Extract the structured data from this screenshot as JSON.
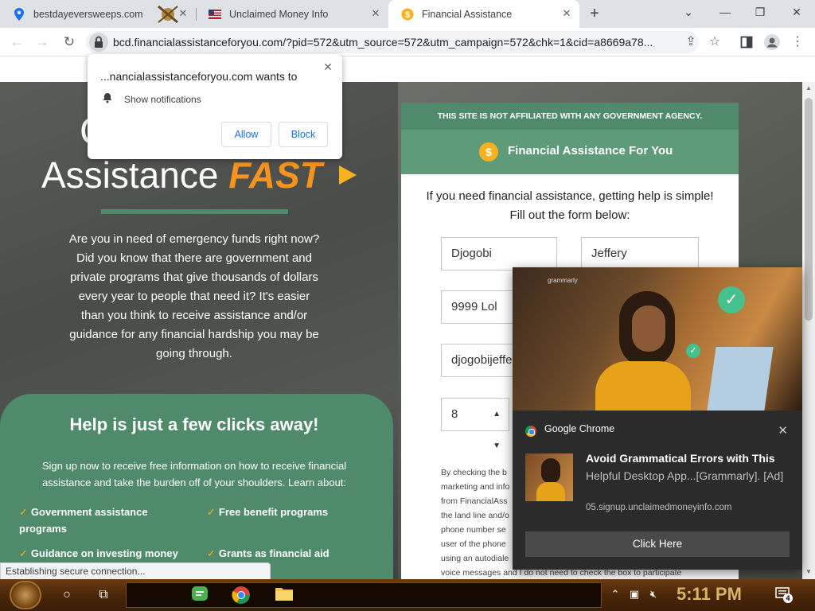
{
  "browser": {
    "tabs": [
      {
        "title": "bestdayeversweeps.com",
        "active": false,
        "favicon": "map-pin-icon"
      },
      {
        "title": "Unclaimed Money Info",
        "active": false,
        "favicon": "us-flag-icon"
      },
      {
        "title": "Financial Assistance",
        "active": true,
        "favicon": "dollar-coin-icon"
      }
    ],
    "url": "bcd.financialassistanceforyou.com/?pid=572&utm_source=572&utm_campaign=572&chk=1&cid=a8669a78...",
    "window_controls": [
      "chevron-down-icon",
      "minimize-icon",
      "restore-icon",
      "close-icon"
    ]
  },
  "permission_prompt": {
    "title": "...nancialassistanceforyou.com wants to",
    "line": "Show notifications",
    "allow_label": "Allow",
    "block_label": "Block"
  },
  "page": {
    "hero_title_main": "Assistance",
    "hero_title_accent": "FAST",
    "hero_body": "Are you in need of emergency funds right now? Did you know that there are government and private programs that give thousands of dollars every year to people that need it? It's easier than you think to receive assistance and/or guidance for any financial hardship you may be going through.",
    "help_title": "Help is just a few clicks away!",
    "help_subtitle": "Sign up now to receive free information on how to receive financial assistance and take the burden off of your shoulders. Learn about:",
    "help_items": [
      "Government assistance programs",
      "Free benefit programs",
      "Guidance on investing money",
      "Grants as financial aid"
    ],
    "form": {
      "notice": "THIS SITE IS NOT AFFILIATED WITH ANY GOVERNMENT AGENCY.",
      "brand": "Financial Assistance For You",
      "intro": "If you need financial assistance, getting help is simple! Fill out the form below:",
      "first_name": "Djogobi",
      "last_name": "Jeffery",
      "address": "9999 Lol",
      "email": "djogobijeffe",
      "select_value": "8",
      "consent_lines": [
        "By checking the b",
        "marketing and info",
        "from FinancialAss",
        "the land line and/o",
        "phone number se",
        "user of the phone",
        "using an autodiale",
        "voice messages and I do not need to check the box to participate"
      ]
    }
  },
  "notification": {
    "brand_mark": "grammarly",
    "app": "Google Chrome",
    "title": "Avoid Grammatical Errors with This",
    "body": "Helpful Desktop App...[Grammarly]. [Ad]",
    "source": "05.signup.unclaimedmoneyinfo.com",
    "button_label": "Click Here"
  },
  "status_text": "Establishing secure connection...",
  "taskbar": {
    "clock": "5:11 PM",
    "notification_count": "4"
  }
}
